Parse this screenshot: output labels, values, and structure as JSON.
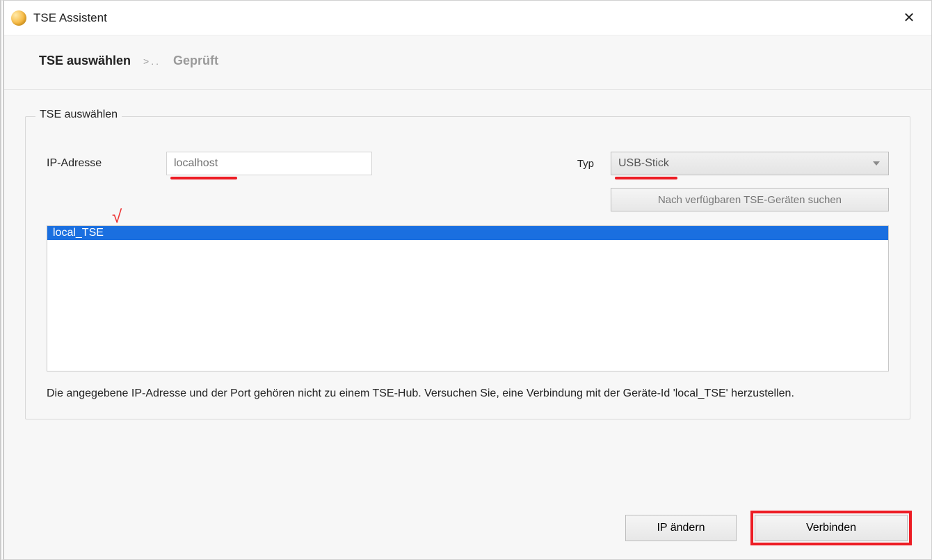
{
  "window": {
    "title": "TSE Assistent"
  },
  "steps": {
    "active": "TSE auswählen",
    "separator": ">..",
    "inactive": "Geprüft"
  },
  "group": {
    "title": "TSE auswählen",
    "ip_label": "IP-Adresse",
    "ip_value": "localhost",
    "typ_label": "Typ",
    "typ_value": "USB-Stick",
    "search_button": "Nach verfügbaren TSE-Geräten suchen",
    "checkmark": "√",
    "list_items": [
      "local_TSE"
    ],
    "status_message": "Die angegebene IP-Adresse und der Port gehören nicht zu einem TSE-Hub. Versuchen Sie, eine Verbindung mit der Geräte-Id 'local_TSE' herzustellen."
  },
  "footer": {
    "ip_change": "IP ändern",
    "connect": "Verbinden"
  },
  "annotations": {
    "ip_underline_width": 96,
    "typ_underline_width": 90,
    "accent_red": "#ed1c24",
    "selection_blue": "#1a6fe0"
  }
}
